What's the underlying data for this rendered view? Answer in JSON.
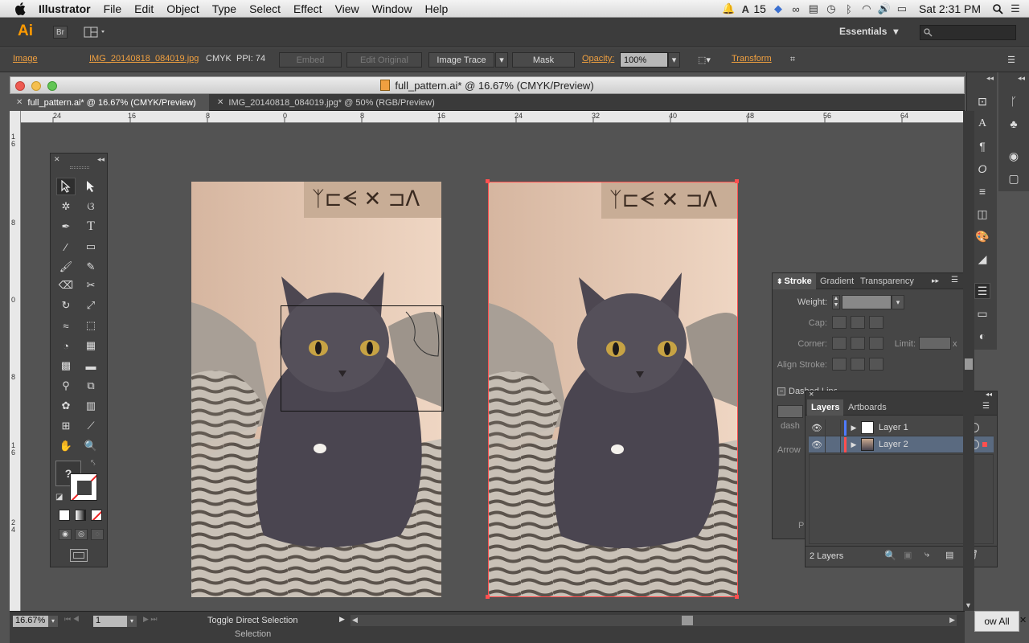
{
  "menubar": {
    "app": "Illustrator",
    "items": [
      "File",
      "Edit",
      "Object",
      "Type",
      "Select",
      "Effect",
      "View",
      "Window",
      "Help"
    ],
    "adobe_count": "15",
    "clock": "Sat 2:31 PM"
  },
  "appbar": {
    "logo": "Ai",
    "bridge": "Br",
    "workspace": "Essentials",
    "search_placeholder": ""
  },
  "control": {
    "type_label": "Image",
    "filename": "IMG_20140818_084019.jpg",
    "color_mode": "CMYK",
    "ppi": "PPI: 74",
    "embed": "Embed",
    "edit_original": "Edit Original",
    "image_trace": "Image Trace",
    "mask": "Mask",
    "opacity_label": "Opacity:",
    "opacity_value": "100%",
    "transform": "Transform"
  },
  "document": {
    "title": "full_pattern.ai* @ 16.67% (CMYK/Preview)",
    "tabs": [
      {
        "label": "full_pattern.ai* @ 16.67% (CMYK/Preview)",
        "active": true
      },
      {
        "label": "IMG_20140818_084019.jpg* @ 50% (RGB/Preview)",
        "active": false
      }
    ],
    "ruler_h": [
      "24",
      "16",
      "8",
      "0",
      "8",
      "16",
      "24",
      "32",
      "40",
      "48",
      "56",
      "64"
    ],
    "ruler_v": [
      "1\n6",
      "8",
      "0",
      "8",
      "1\n6",
      "2\n4"
    ]
  },
  "stroke_panel": {
    "tabs": [
      "Stroke",
      "Gradient",
      "Transparency"
    ],
    "weight": "Weight:",
    "cap": "Cap:",
    "corner": "Corner:",
    "limit": "Limit:",
    "limit_x": "x",
    "align": "Align Stroke:",
    "dashed": "Dashed Line",
    "dash": "dash",
    "arrowheads": "Arrow",
    "profile": "P"
  },
  "layers_panel": {
    "tabs": [
      "Layers",
      "Artboards"
    ],
    "layers": [
      {
        "name": "Layer 1",
        "color": "#4f7bff"
      },
      {
        "name": "Layer 2",
        "color": "#ff4f4f"
      }
    ],
    "count": "2 Layers"
  },
  "status": {
    "zoom": "16.67%",
    "artboard": "1",
    "hint": "Toggle Direct Selection",
    "tool": "Selection",
    "show_all": "ow All"
  },
  "colors": {
    "accent": "#ff9a00",
    "selection": "#ff4f4f",
    "panel": "#424242",
    "canvas": "#535353"
  }
}
